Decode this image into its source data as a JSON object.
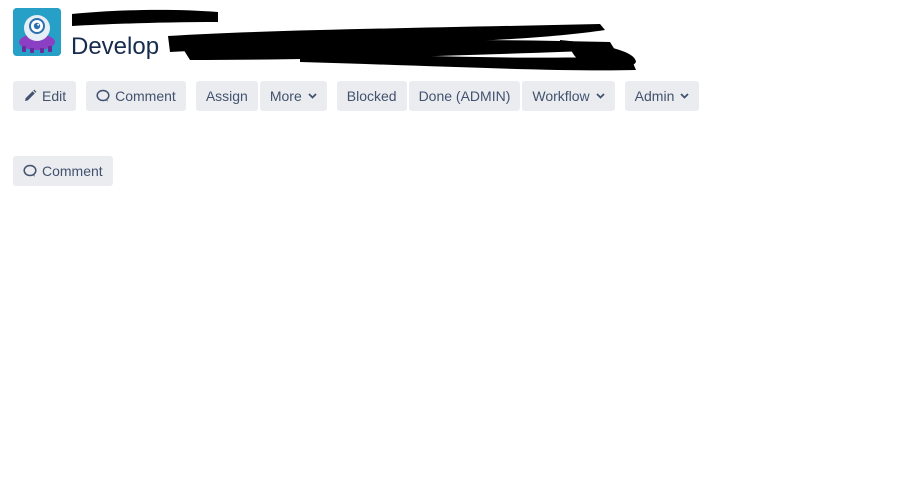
{
  "header": {
    "avatar_icon": "project-avatar-icon",
    "title_prefix": "Develop"
  },
  "toolbar": {
    "edit_label": "Edit",
    "edit_icon": "pencil-icon",
    "comment_label": "Comment",
    "comment_icon": "comment-bubble-icon",
    "assign_label": "Assign",
    "more_label": "More",
    "blocked_label": "Blocked",
    "done_label": "Done (ADMIN)",
    "workflow_label": "Workflow",
    "admin_label": "Admin",
    "chevron_icon": "chevron-down-icon"
  },
  "activity": {
    "comment_label": "Comment"
  },
  "colors": {
    "button_bg": "#ebecf0",
    "button_text": "#42526e",
    "title_text": "#172b4d",
    "avatar_bg": "#26a0c6",
    "avatar_accent": "#8b3fc2"
  }
}
